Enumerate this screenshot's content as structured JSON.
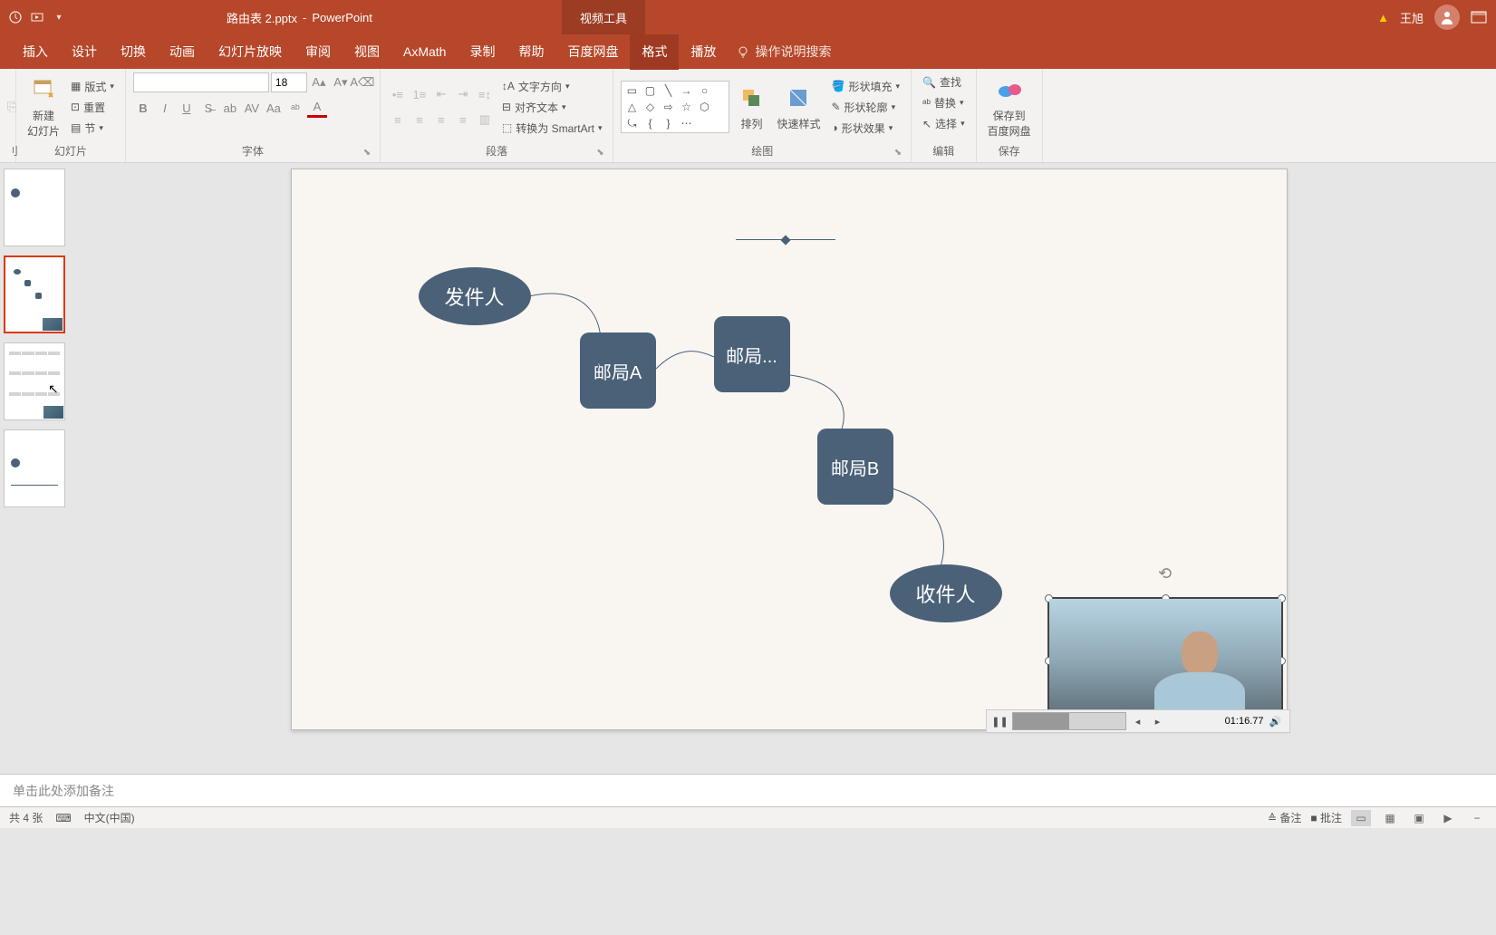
{
  "title": {
    "filename": "路由表 2.pptx",
    "app": "PowerPoint",
    "contextual_tab": "视频工具"
  },
  "user": {
    "name": "王旭"
  },
  "tabs": {
    "insert": "插入",
    "design": "设计",
    "transitions": "切换",
    "animations": "动画",
    "slideshow": "幻灯片放映",
    "review": "审阅",
    "view": "视图",
    "axmath": "AxMath",
    "record": "录制",
    "help": "帮助",
    "baidu": "百度网盘",
    "format": "格式",
    "playback": "播放",
    "tell_me": "操作说明搜索"
  },
  "ribbon": {
    "slides": {
      "new_slide": "新建\n幻灯片",
      "layout": "版式",
      "reset": "重置",
      "section": "节",
      "group": "幻灯片"
    },
    "font": {
      "size": "18",
      "group": "字体"
    },
    "paragraph": {
      "text_direction": "文字方向",
      "align_text": "对齐文本",
      "smartart": "转换为 SmartArt",
      "group": "段落"
    },
    "drawing": {
      "arrange": "排列",
      "quick_styles": "快速样式",
      "shape_fill": "形状填充",
      "shape_outline": "形状轮廓",
      "shape_effects": "形状效果",
      "group": "绘图"
    },
    "editing": {
      "find": "查找",
      "replace": "替换",
      "select": "选择",
      "group": "编辑"
    },
    "save": {
      "save_to": "保存到\n百度网盘",
      "group": "保存"
    }
  },
  "diagram": {
    "sender": "发件人",
    "post_a": "邮局A",
    "post_dots": "邮局...",
    "post_b": "邮局B",
    "receiver": "收件人"
  },
  "video": {
    "time": "01:16.77"
  },
  "notes": {
    "placeholder": "单击此处添加备注"
  },
  "status": {
    "slide_count": "共 4 张",
    "language": "中文(中国)",
    "notes_btn": "备注",
    "comments_btn": "批注"
  },
  "chart_data": {
    "type": "table",
    "title": "Mail routing diagram",
    "nodes": [
      {
        "id": "sender",
        "label": "发件人",
        "shape": "ellipse"
      },
      {
        "id": "postA",
        "label": "邮局A",
        "shape": "rounded-rect"
      },
      {
        "id": "postDots",
        "label": "邮局...",
        "shape": "rounded-rect"
      },
      {
        "id": "postB",
        "label": "邮局B",
        "shape": "rounded-rect"
      },
      {
        "id": "receiver",
        "label": "收件人",
        "shape": "ellipse"
      }
    ],
    "edges": [
      [
        "sender",
        "postA"
      ],
      [
        "postA",
        "postDots"
      ],
      [
        "postDots",
        "postB"
      ],
      [
        "postB",
        "receiver"
      ]
    ]
  }
}
